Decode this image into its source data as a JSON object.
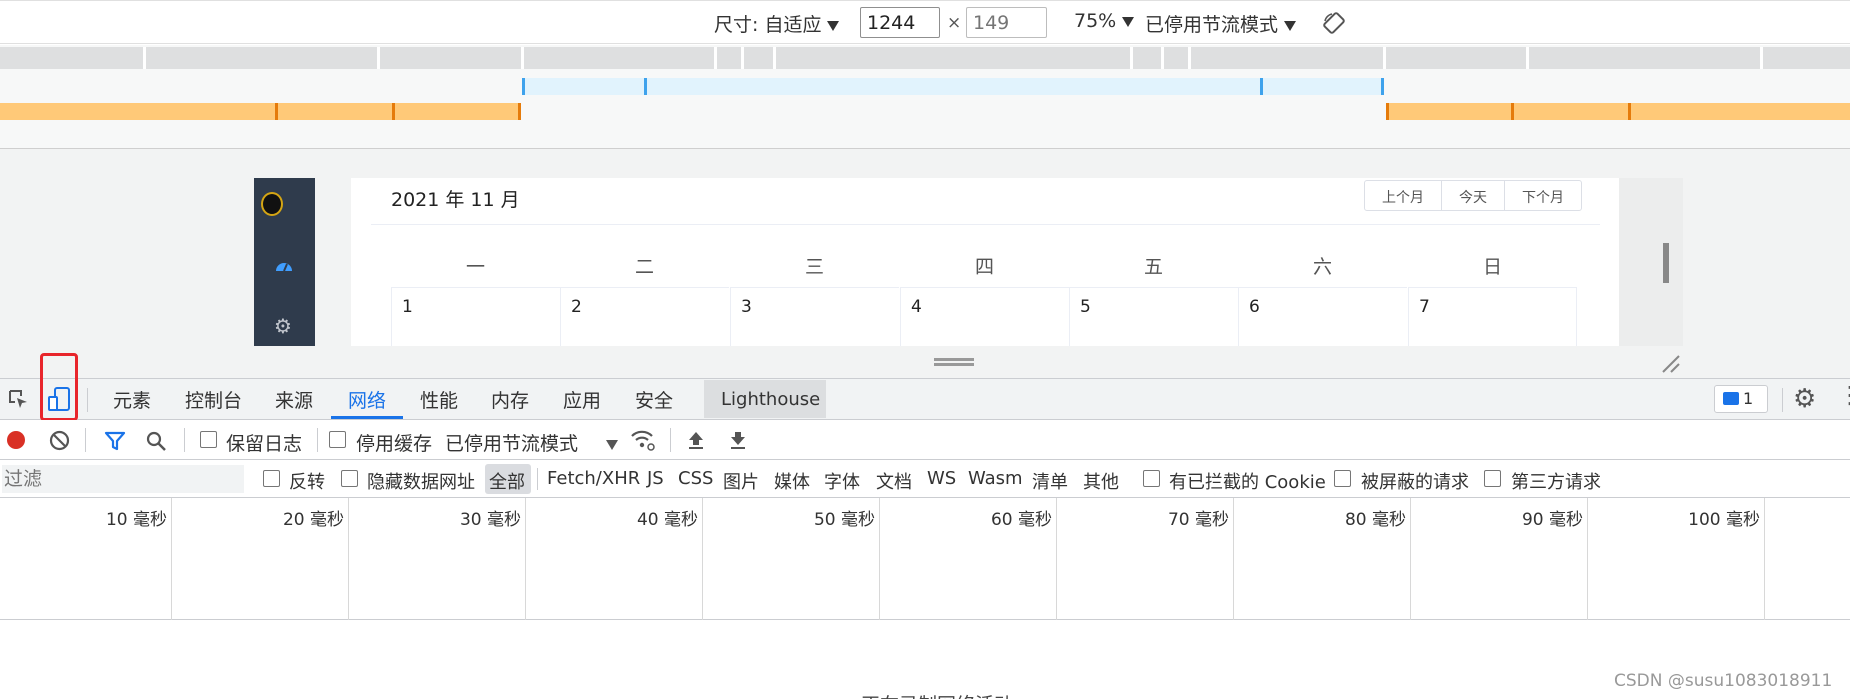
{
  "device_toolbar": {
    "size_label": "尺寸: 自适应",
    "width_value": "1244",
    "height_placeholder": "149",
    "times": "×",
    "zoom": "75%",
    "throttle": "已停用节流模式",
    "rotate_icon": "rotate-icon"
  },
  "calendar": {
    "title": "2021 年 11 月",
    "prev_month": "上个月",
    "today": "今天",
    "next_month": "下个月",
    "weekdays": [
      "一",
      "二",
      "三",
      "四",
      "五",
      "六",
      "日"
    ],
    "days": [
      "1",
      "2",
      "3",
      "4",
      "5",
      "6",
      "7"
    ]
  },
  "devtools_tabs": {
    "elements": "元素",
    "console": "控制台",
    "sources": "来源",
    "network": "网络",
    "performance": "性能",
    "memory": "内存",
    "application": "应用",
    "security": "安全",
    "lighthouse": "Lighthouse",
    "issues_count": "1"
  },
  "network_toolbar": {
    "preserve_log": "保留日志",
    "disable_cache": "停用缓存",
    "throttle": "已停用节流模式"
  },
  "filter_bar": {
    "placeholder": "过滤",
    "invert": "反转",
    "hide_data_urls": "隐藏数据网址",
    "all": "全部",
    "fetch_xhr": "Fetch/XHR",
    "js": "JS",
    "css": "CSS",
    "img": "图片",
    "media": "媒体",
    "font": "字体",
    "doc": "文档",
    "ws": "WS",
    "wasm": "Wasm",
    "manifest": "清单",
    "other": "其他",
    "blocked_cookies": "有已拦截的 Cookie",
    "blocked_requests": "被屏蔽的请求",
    "third_party": "第三方请求"
  },
  "timeline": {
    "labels": [
      "10 毫秒",
      "20 毫秒",
      "30 毫秒",
      "40 毫秒",
      "50 毫秒",
      "60 毫秒",
      "70 毫秒",
      "80 毫秒",
      "90 毫秒",
      "100 毫秒"
    ]
  },
  "recording_message": "正在录制网络活动…",
  "watermark": "CSDN @susu1083018911",
  "colors": {
    "accent": "#1a73e8",
    "record_red": "#d93025",
    "highlight_box": "#e8252b"
  }
}
